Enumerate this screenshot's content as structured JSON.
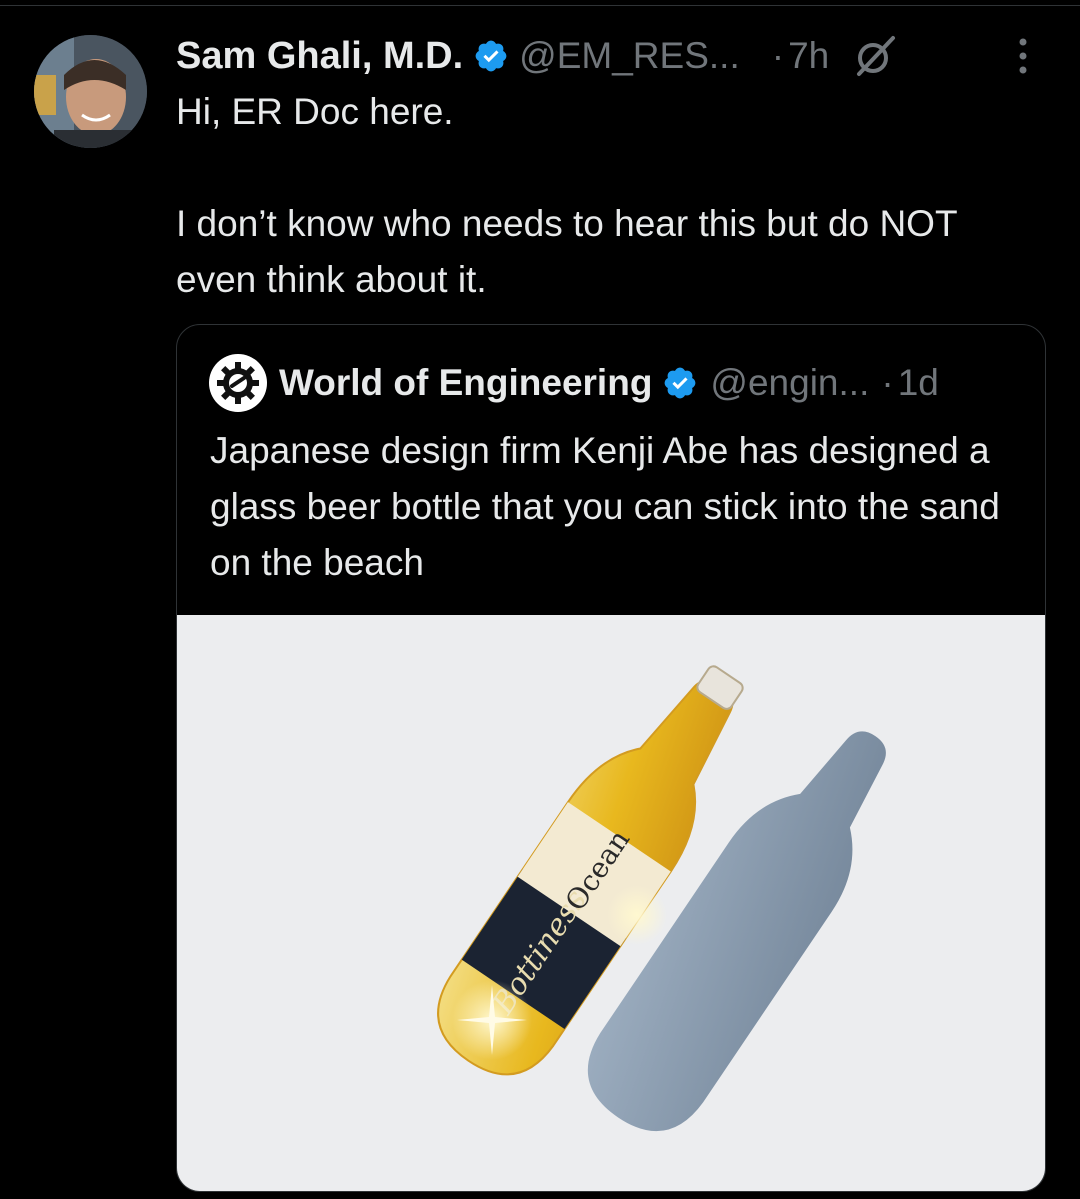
{
  "tweet": {
    "author": {
      "display_name": "Sam Ghali, M.D.",
      "handle": "@EM_RES...",
      "verified": true
    },
    "timestamp": "7h",
    "separator": "·",
    "text_lines": [
      "Hi, ER Doc here.",
      "I don’t know who needs to hear this but do NOT even think about it."
    ],
    "icons": {
      "verified": "verified-badge-icon",
      "grok": "grok-icon",
      "more": "more-options-icon"
    }
  },
  "quoted_tweet": {
    "author": {
      "display_name": "World of Engineering",
      "handle": "@engin...",
      "verified": true
    },
    "timestamp": "1d",
    "separator": "·",
    "text": "Japanese design firm Kenji Abe has designed a glass beer bottle that you can stick into the sand on the beach",
    "media": {
      "type": "image",
      "subject": "beer-bottle-photo",
      "label_text": "Ocean Bottiness"
    }
  },
  "colors": {
    "background": "#000000",
    "text_primary": "#e7e9ea",
    "text_secondary": "#71767b",
    "verified_blue": "#1d9bf0",
    "border": "#2f3336",
    "media_bg": "#ecedef"
  }
}
